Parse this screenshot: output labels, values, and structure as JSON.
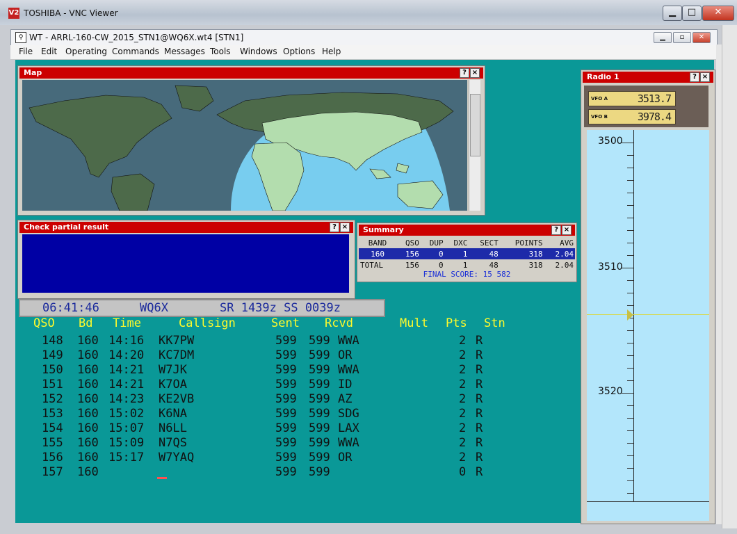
{
  "vnc": {
    "title": "TOSHIBA - VNC Viewer",
    "logo": "V2",
    "icons": [
      "minimize-icon",
      "maximize-icon",
      "close-icon"
    ]
  },
  "wt": {
    "title": "WT - ARRL-160-CW_2015_STN1@WQ6X.wt4 [STN1]"
  },
  "menu": [
    "File",
    "Edit",
    "Operating",
    "Commands",
    "Messages",
    "Tools",
    "Windows",
    "Options",
    "Help"
  ],
  "map": {
    "title": "Map",
    "help": "?",
    "close": "×"
  },
  "check": {
    "title": "Check partial result",
    "help": "?",
    "close": "×"
  },
  "summary": {
    "title": "Summary",
    "help": "?",
    "close": "×",
    "headers": [
      "BAND",
      "QSO",
      "DUP",
      "DXC",
      "SECT",
      "POINTS",
      "AVG"
    ],
    "rows": [
      [
        "160",
        "156",
        "0",
        "1",
        "48",
        "318",
        "2.04"
      ],
      [
        "TOTAL",
        "156",
        "0",
        "1",
        "48",
        "318",
        "2.04"
      ]
    ],
    "final": "FINAL SCORE: 15 582"
  },
  "status": {
    "time": "06:41:46",
    "call": "WQ6X",
    "sr_ss": "SR 1439z SS 0039z"
  },
  "log": {
    "headers": [
      "QSO",
      "Bd",
      "Time",
      "Callsign",
      "Sent",
      "Rcvd",
      "Mult",
      "Pts",
      "Stn"
    ],
    "rows": [
      [
        "148",
        "160",
        "14:16",
        "KK7PW",
        "599",
        "599",
        "WWA",
        "2",
        "R"
      ],
      [
        "149",
        "160",
        "14:20",
        "KC7DM",
        "599",
        "599",
        "OR",
        "2",
        "R"
      ],
      [
        "150",
        "160",
        "14:21",
        "W7JK",
        "599",
        "599",
        "WWA",
        "2",
        "R"
      ],
      [
        "151",
        "160",
        "14:21",
        "K7OA",
        "599",
        "599",
        "ID",
        "2",
        "R"
      ],
      [
        "152",
        "160",
        "14:23",
        "KE2VB",
        "599",
        "599",
        "AZ",
        "2",
        "R"
      ],
      [
        "153",
        "160",
        "15:02",
        "K6NA",
        "599",
        "599",
        "SDG",
        "2",
        "R"
      ],
      [
        "154",
        "160",
        "15:07",
        "N6LL",
        "599",
        "599",
        "LAX",
        "2",
        "R"
      ],
      [
        "155",
        "160",
        "15:09",
        "N7QS",
        "599",
        "599",
        "WWA",
        "2",
        "R"
      ],
      [
        "156",
        "160",
        "15:17",
        "W7YAQ",
        "599",
        "599",
        "OR",
        "2",
        "R"
      ],
      [
        "157",
        "160",
        "",
        "",
        "599",
        "599",
        "",
        "0",
        "R"
      ]
    ]
  },
  "radio": {
    "title": "Radio 1",
    "help": "?",
    "close": "×",
    "vfo_a_label": "VFO A",
    "vfo_a": "3513.7",
    "vfo_b_label": "VFO B",
    "vfo_b": "3978.4",
    "scale": [
      "3500",
      "3510",
      "3520"
    ]
  },
  "colors": {
    "teal": "#0a9897",
    "titlebar": "#cc0000",
    "header": "#fffa2c",
    "entry": "#0000a4"
  }
}
